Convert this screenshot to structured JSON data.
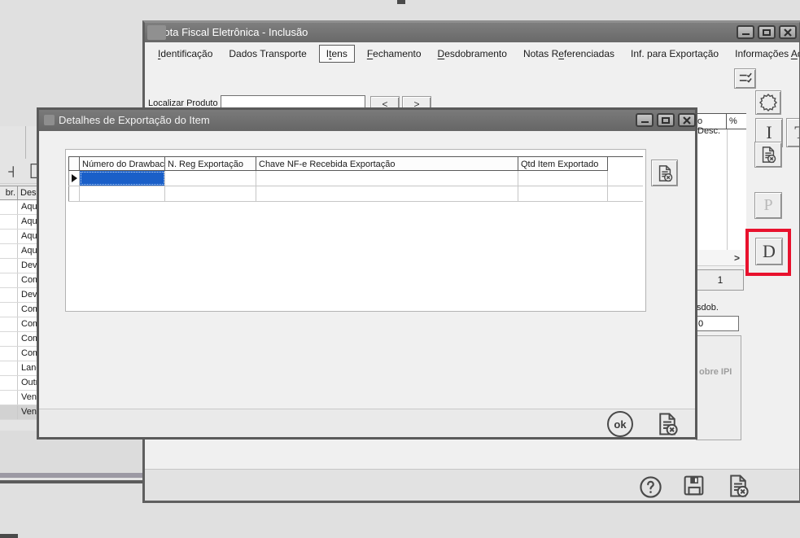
{
  "colors": {
    "highlight_box": "#e8112d",
    "grid_selection": "#1a5fc8",
    "titlebar": "#6e6e6e"
  },
  "left_window": {
    "table": {
      "headers": [
        "br.",
        "Descr"
      ],
      "rows": [
        "Aquis",
        "Aquis",
        "Aquis",
        "Aquis",
        "Devo",
        "Comp",
        "Devo",
        "Comp",
        "Comp",
        "Comp",
        "Comp",
        "Lança",
        "Outra",
        "Venda",
        "Venda"
      ],
      "selected_row_index": 14
    }
  },
  "main_window": {
    "title": "Nota Fiscal Eletrônica - Inclusão",
    "tabs": [
      {
        "label_html": "<u>I</u>dentificação",
        "active": false
      },
      {
        "label_html": "Dados Transporte",
        "active": false
      },
      {
        "label_html": "I<u>t</u>ens",
        "active": true
      },
      {
        "label_html": "<u>F</u>echamento",
        "active": false
      },
      {
        "label_html": "<u>D</u>esdobramento",
        "active": false
      },
      {
        "label_html": "Notas R<u>e</u>ferenciadas",
        "active": false
      },
      {
        "label_html": "Inf. para Exportação",
        "active": false
      },
      {
        "label_html": "Informações <u>A</u>dicionai",
        "active": false
      }
    ],
    "locate_product": {
      "label": "Localizar Produto",
      "value": "",
      "prev": "<",
      "next": ">"
    },
    "items_grid_fragment": {
      "header_col1": "o Desc.",
      "header_col2": "%",
      "scroll_next": ">",
      "page": "1"
    },
    "desdob_fragment": {
      "label": "sdob.",
      "value": "0"
    },
    "ipi_fragment": {
      "label": "obre IPI"
    },
    "side_buttons": {
      "italic": "I",
      "text": "T",
      "p": "P",
      "d": "D"
    },
    "help_glyph": "?"
  },
  "dialog": {
    "title": "Detalhes de Exportação do Item",
    "grid": {
      "columns": [
        "Número do Drawback",
        "N. Reg Exportação",
        "Chave NF-e Recebida Exportação",
        "Qtd Item Exportado"
      ]
    },
    "ok_label": "ok"
  }
}
